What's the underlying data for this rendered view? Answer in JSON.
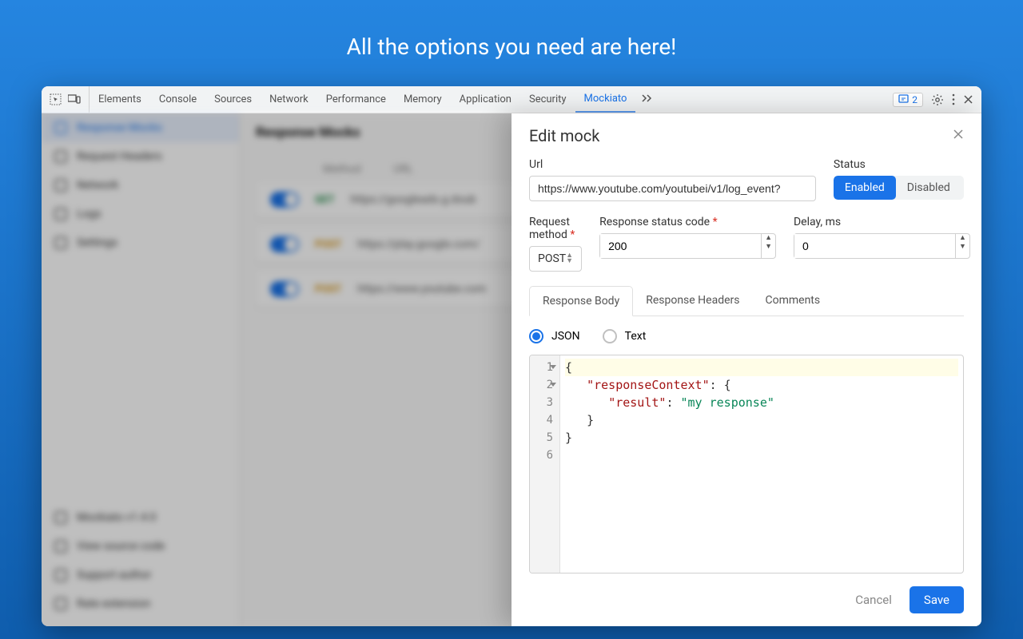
{
  "headline": "All the options you need are here!",
  "topbar": {
    "tabs": [
      "Elements",
      "Console",
      "Sources",
      "Network",
      "Performance",
      "Memory",
      "Application",
      "Security",
      "Mockiato"
    ],
    "badge_count": "2"
  },
  "sidebar": {
    "items": [
      {
        "label": "Response Mocks"
      },
      {
        "label": "Request Headers"
      },
      {
        "label": "Network"
      },
      {
        "label": "Logs"
      },
      {
        "label": "Settings"
      }
    ],
    "footer": [
      {
        "label": "Mockiato v1.4.0"
      },
      {
        "label": "View source code"
      },
      {
        "label": "Support author"
      },
      {
        "label": "Rate extension"
      }
    ]
  },
  "main": {
    "title": "Response Mocks",
    "head_method": "Method",
    "head_url": "URL",
    "rows": [
      {
        "method": "GET",
        "url": "https://googleads.g.doub"
      },
      {
        "method": "POST",
        "url": "https://play.google.com/"
      },
      {
        "method": "POST",
        "url": "https://www.youtube.com"
      }
    ]
  },
  "panel": {
    "title": "Edit mock",
    "url_label": "Url",
    "url_value": "https://www.youtube.com/youtubei/v1/log_event?",
    "status_label": "Status",
    "status_enabled": "Enabled",
    "status_disabled": "Disabled",
    "method_label": "Request method",
    "method_value": "POST",
    "code_label": "Response status code",
    "code_value": "200",
    "delay_label": "Delay, ms",
    "delay_value": "0",
    "tabs": {
      "body": "Response Body",
      "headers": "Response Headers",
      "comments": "Comments"
    },
    "format_json": "JSON",
    "format_text": "Text",
    "lines": {
      "l1": "1",
      "l2": "2",
      "l3": "3",
      "l4": "4",
      "l5": "5",
      "l6": "6"
    },
    "cancel": "Cancel",
    "save": "Save"
  }
}
